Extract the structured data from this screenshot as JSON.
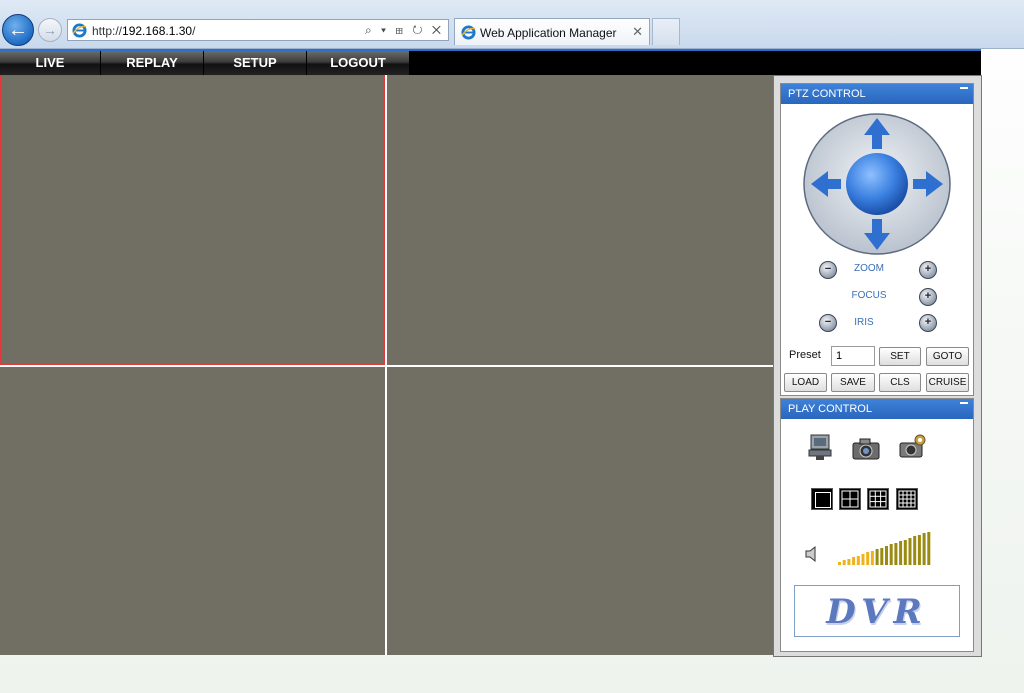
{
  "browser": {
    "url_prefix": "http://",
    "url_host": "192.168.1.30",
    "url_suffix": "/",
    "address_tools": "⌕ ▾ ⊞ ↻ ✕",
    "tab_title": "Web Application Manager",
    "tab_close": "✕"
  },
  "nav": {
    "items": [
      {
        "label": "LIVE"
      },
      {
        "label": "REPLAY"
      },
      {
        "label": "SETUP"
      },
      {
        "label": "LOGOUT"
      }
    ]
  },
  "ptz": {
    "title": "PTZ CONTROL",
    "zoom_label": "ZOOM",
    "focus_label": "FOCUS",
    "iris_label": "IRIS",
    "minus": "−",
    "plus": "+",
    "preset_label": "Preset",
    "preset_value": "1",
    "buttons": {
      "set": "SET",
      "goto": "GOTO",
      "load": "LOAD",
      "save": "SAVE",
      "cls": "CLS",
      "cruise": "CRUISE"
    }
  },
  "play": {
    "title": "PLAY CONTROL",
    "volume_level": 0.75,
    "logo_text": "DVR"
  },
  "colors": {
    "video_bg": "#716e64",
    "selected_border": "#e0393b",
    "panel_header": "#2f6fc6"
  }
}
